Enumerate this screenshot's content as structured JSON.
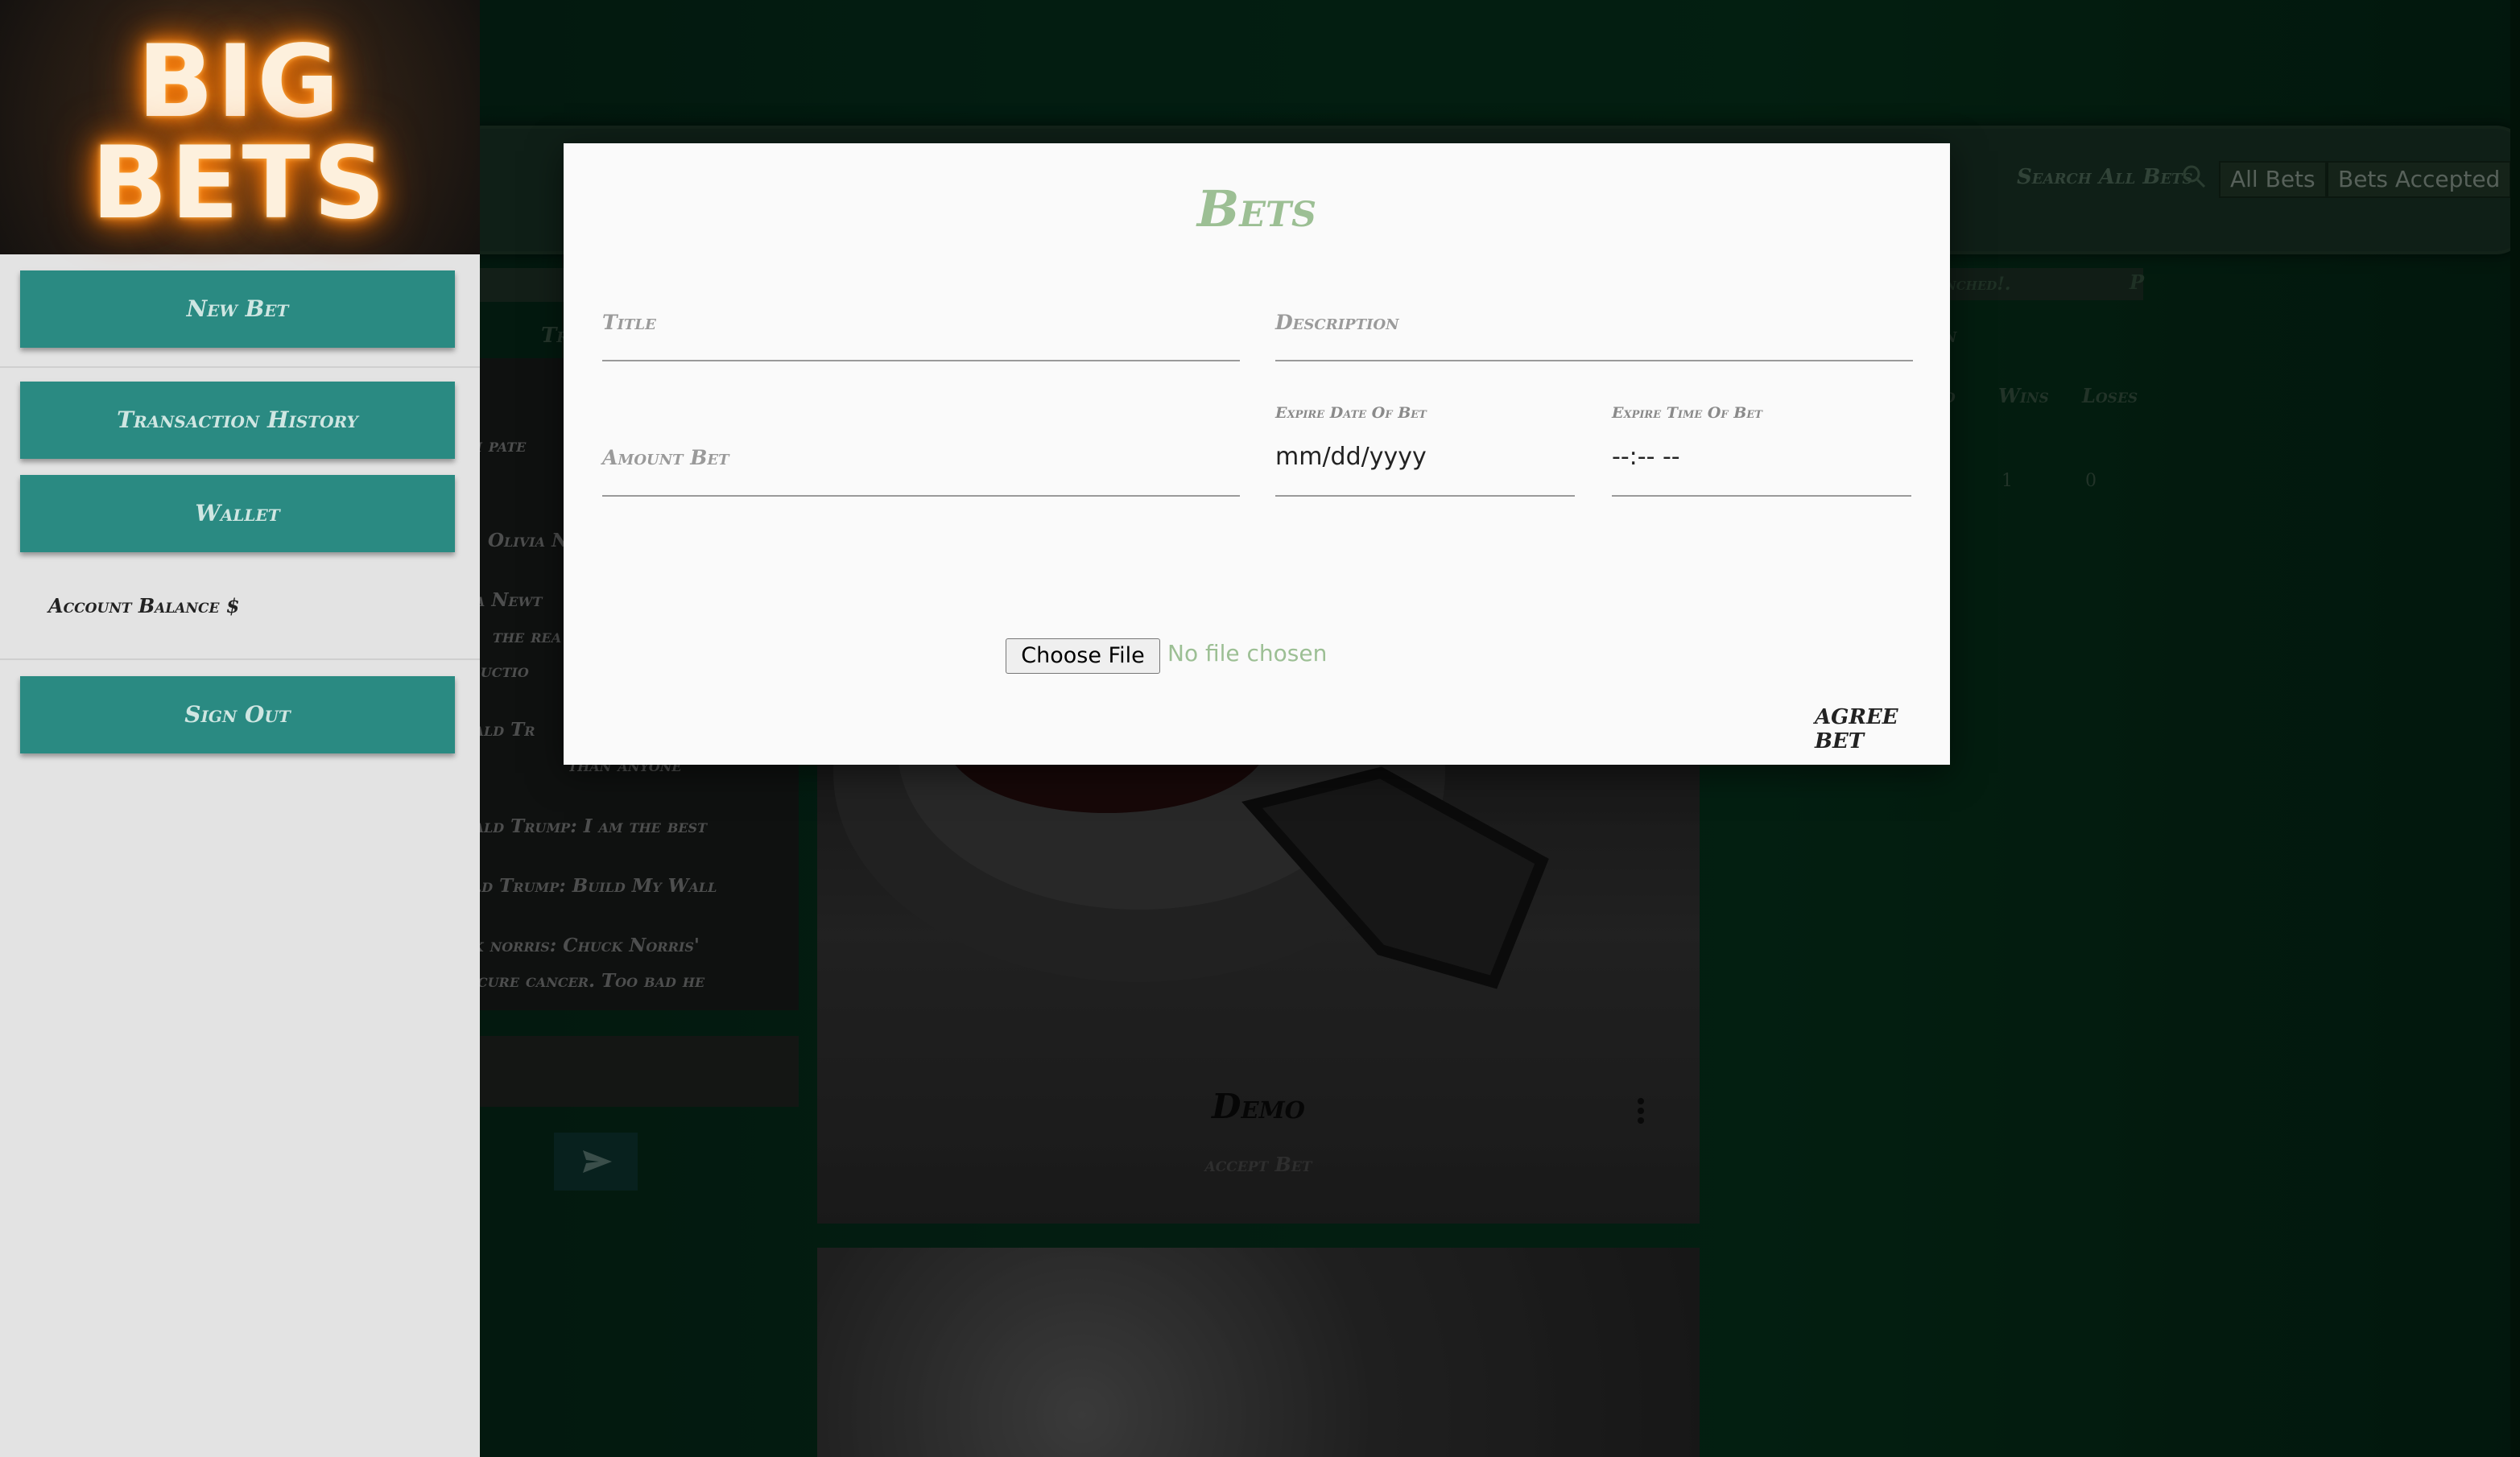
{
  "colors": {
    "page_bg": "#062a18",
    "sidebar_bg": "#e3e3e3",
    "sidebar_button": "#2a8a82",
    "modal_bg": "#fafafa",
    "modal_title": "#9cbf94",
    "file_status": "#9cbf94"
  },
  "logo": {
    "line1": "BIG",
    "line2": "BETS"
  },
  "sidebar": {
    "new_bet": "New Bet",
    "transaction_history": "Transaction History",
    "wallet": "Wallet",
    "account_balance": "Account Balance $",
    "sign_out": "Sign Out"
  },
  "header": {
    "search_label": "Search All Bets",
    "search_icon": "search-icon",
    "tabs": [
      "All Bets",
      "Bets Accepted"
    ]
  },
  "background": {
    "right_input_text": "nched!.",
    "right_input_suffix": "P",
    "stats_partial": "d",
    "stats_wins": "Wins",
    "stats_loses": "Loses",
    "wins_value": "1",
    "loses_value": "0",
    "chat_tab": "Tr",
    "chat": [
      "esh pate",
      "Olivia N",
      "via Newt",
      "the rea",
      "structio",
      "onald Tr",
      "than anyone",
      "onald Trump: I am the best",
      "nald Trump: Build My Wall",
      "uck norris: Chuck Norris'",
      "rs cure cancer. Too bad he"
    ],
    "send_icon": "send-icon",
    "card_title": "Demo",
    "card_action": "accept Bet",
    "card_menu_icon": "more-vertical-icon"
  },
  "modal": {
    "title": "Bets",
    "title_label": "Title",
    "description_label": "Description",
    "amount_label": "Amount Bet",
    "expire_date_label": "Expire Date Of Bet",
    "expire_date_value": "mm/dd/yyyy",
    "expire_time_label": "Expire Time Of Bet",
    "expire_time_value": "--:-- --",
    "choose_file": "Choose File",
    "file_status": "No file chosen",
    "agree": "AGREE BET"
  }
}
